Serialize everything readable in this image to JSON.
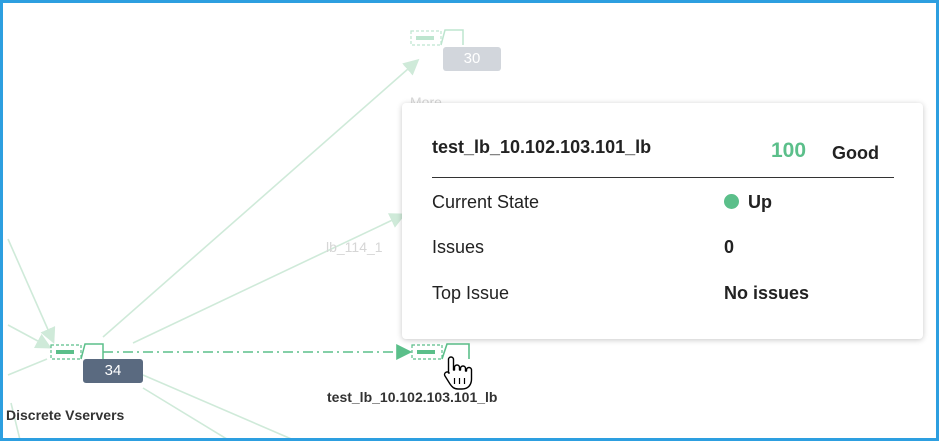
{
  "colors": {
    "accent_green": "#5bbf8a",
    "edge_green": "#cfead9",
    "badge_dark": "#5a6a80",
    "badge_faded": "#d2d6dc",
    "frame_blue": "#2d9fe0"
  },
  "graph": {
    "nodes": {
      "discrete": {
        "count": "34",
        "label": "Discrete Vservers"
      },
      "more": {
        "count": "30",
        "label": "More"
      },
      "lb114": {
        "label": "lb_114_1"
      },
      "test_lb": {
        "label": "test_lb_10.102.103.101_lb"
      }
    }
  },
  "tooltip": {
    "title": "test_lb_10.102.103.101_lb",
    "score": "100",
    "status": "Good",
    "rows": [
      {
        "key": "Current State",
        "value": "Up",
        "indicator": "green-dot"
      },
      {
        "key": "Issues",
        "value": "0"
      },
      {
        "key": "Top Issue",
        "value": "No issues"
      }
    ]
  },
  "icons": [
    "vserver-node-icon",
    "hand-pointer-cursor-icon",
    "state-dot-icon"
  ]
}
